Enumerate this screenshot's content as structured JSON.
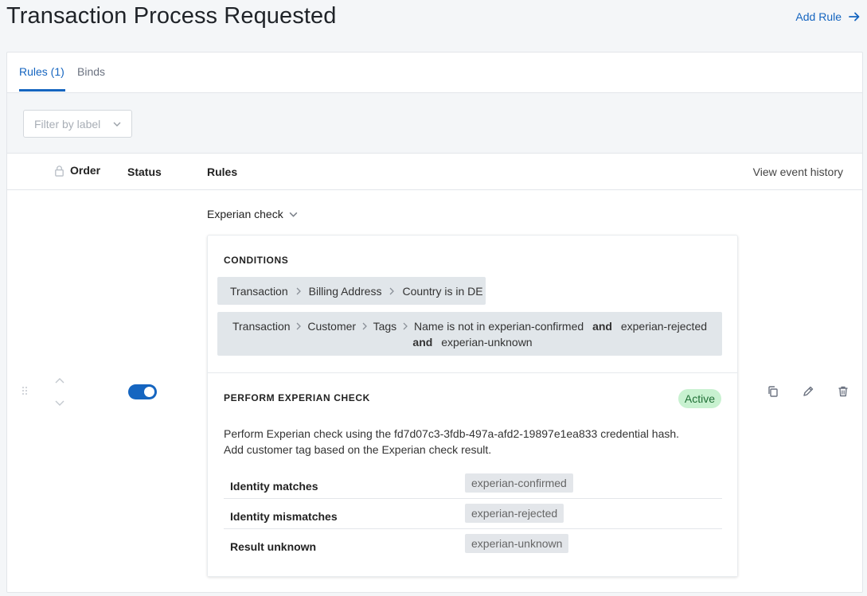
{
  "header": {
    "title": "Transaction Process Requested",
    "add_rule_label": "Add Rule"
  },
  "tabs": [
    {
      "label": "Rules (1)",
      "active": true
    },
    {
      "label": "Binds",
      "active": false
    }
  ],
  "filter": {
    "placeholder": "Filter by label"
  },
  "table": {
    "columns": {
      "order": "Order",
      "status": "Status",
      "rules": "Rules"
    },
    "view_history_label": "View event history"
  },
  "rule": {
    "name": "Experian check",
    "enabled": true,
    "conditions_title": "CONDITIONS",
    "condition_1": {
      "path": [
        "Transaction",
        "Billing Address",
        "Country is in DE"
      ]
    },
    "condition_2": {
      "path": [
        "Transaction",
        "Customer",
        "Tags",
        "Name is not in experian-confirmed"
      ],
      "and_1": "and",
      "value_2": "experian-rejected",
      "and_2": "and",
      "value_3": "experian-unknown"
    },
    "action_title": "PERFORM EXPERIAN CHECK",
    "status_badge": "Active",
    "description_line_1": "Perform Experian check using the fd7d07c3-3fdb-497a-afd2-19897e1ea833 credential hash.",
    "description_line_2": "Add customer tag based on the Experian check result.",
    "results": [
      {
        "label": "Identity matches",
        "tag": "experian-confirmed"
      },
      {
        "label": "Identity mismatches",
        "tag": "experian-rejected"
      },
      {
        "label": "Result unknown",
        "tag": "experian-unknown"
      }
    ]
  },
  "colors": {
    "accent": "#1565c0",
    "active_badge_bg": "#c8f1d0",
    "active_badge_text": "#1f6f35"
  }
}
